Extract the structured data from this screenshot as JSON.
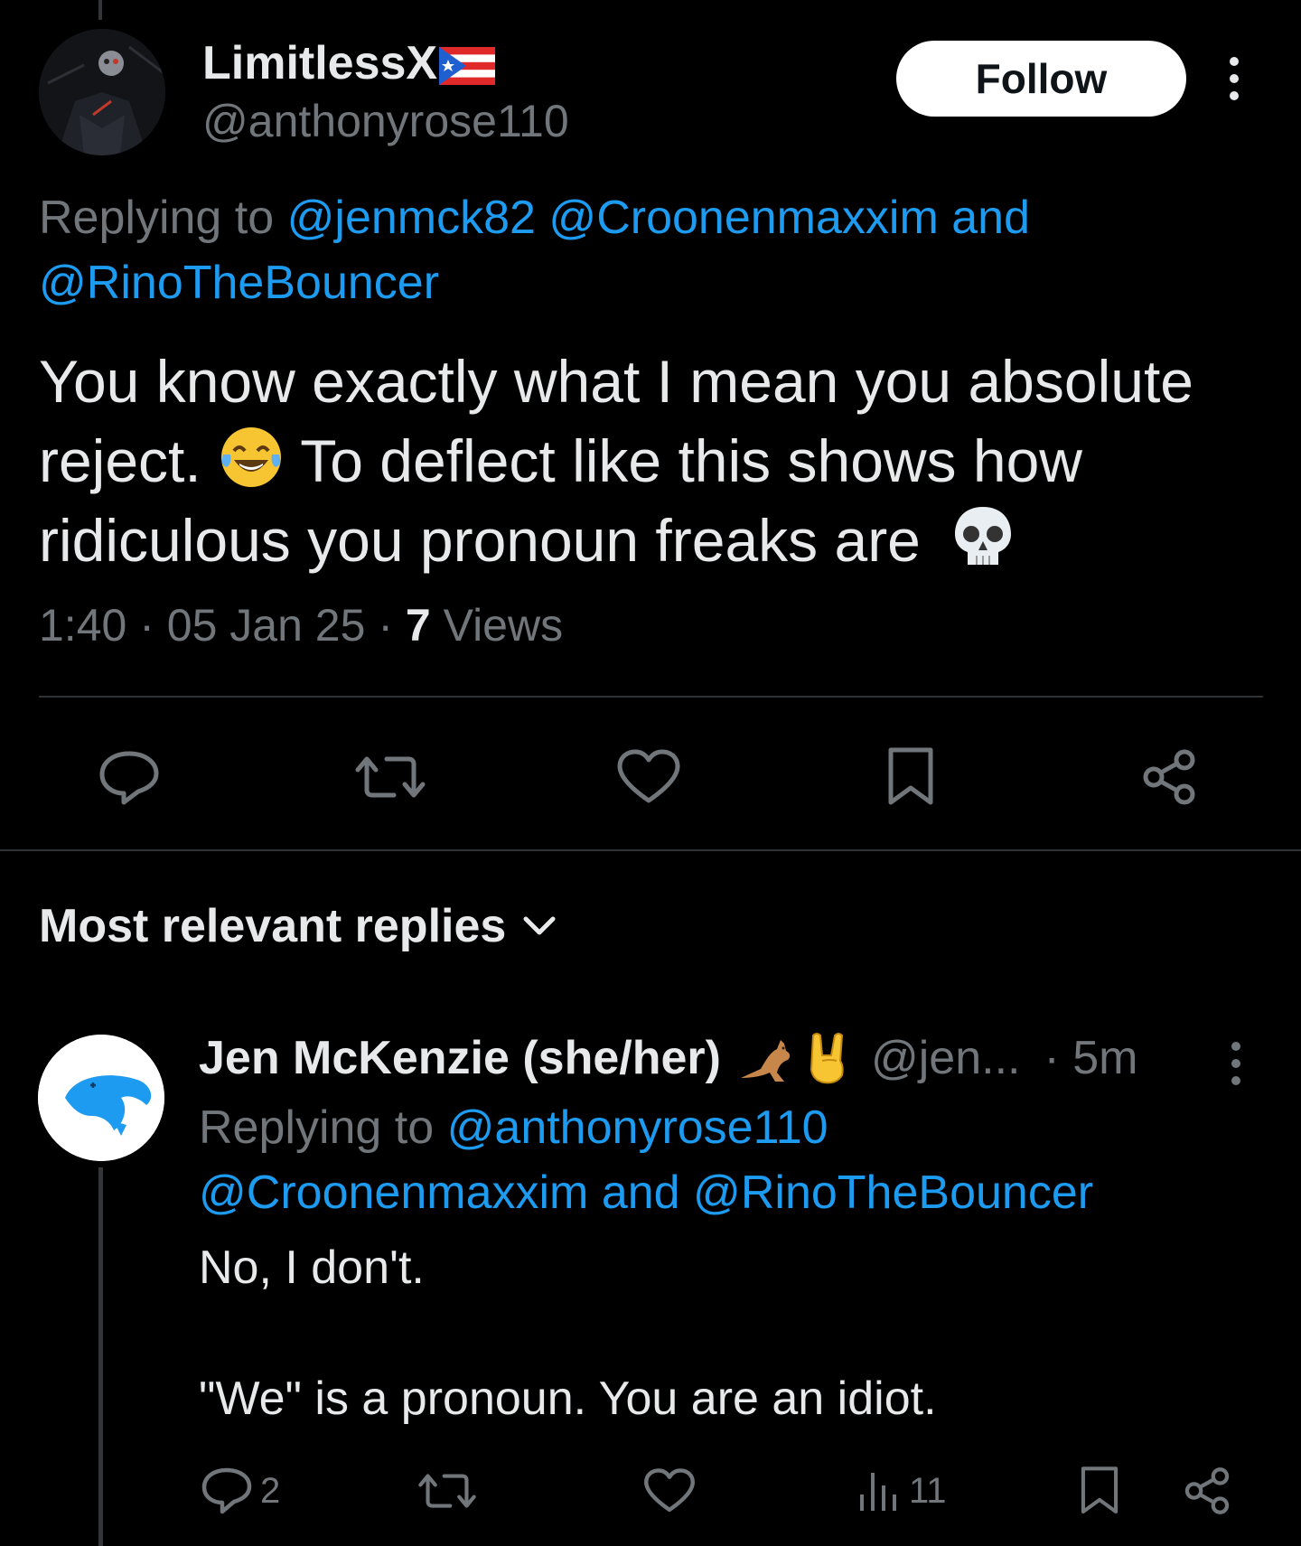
{
  "tweet": {
    "display_name": "LimitlessX",
    "flag_icon": "puerto-rico-flag-icon",
    "handle": "@anthonyrose110",
    "follow_label": "Follow",
    "replying_prefix": "Replying to",
    "replying_user_1": "@jenmck82",
    "replying_user_2": "@Croonenmaxxim",
    "replying_and": "and",
    "replying_user_3": "@RinoTheBouncer",
    "text_line_1": "You know exactly what I mean you absolute",
    "text_line_2a": "reject.",
    "text_line_2b": "To deflect like this shows how",
    "text_line_3": "ridiculous you pronoun freaks are",
    "emoji_1": "face-with-tears-of-joy-icon",
    "emoji_2": "skull-icon",
    "time": "1:40",
    "dot": "·",
    "date": "05 Jan 25",
    "views_count": "7",
    "views_label": "Views",
    "actions": [
      "reply-icon",
      "retweet-icon",
      "like-icon",
      "bookmark-icon",
      "share-icon"
    ]
  },
  "replies_section": {
    "sort_label": "Most relevant replies"
  },
  "reply": {
    "display_name": "Jen McKenzie (she/her)",
    "name_emojis": [
      "kangaroo-icon",
      "sign-of-the-horns-icon"
    ],
    "handle": "@jen...",
    "time": "· 5m",
    "replying_prefix": "Replying to",
    "replying_user_1": "@anthonyrose110",
    "replying_user_2": "@Croonenmaxxim",
    "replying_and": "and",
    "replying_user_3": "@RinoTheBouncer",
    "text_line_1": "No, I don't.",
    "text_line_2": "\"We\" is a pronoun. You are an idiot.",
    "reply_count": "2",
    "view_count": "11"
  },
  "colors": {
    "background": "#000000",
    "text": "#e7e9ea",
    "secondary": "#71767b",
    "link": "#1d9bf0",
    "divider": "#2f3336"
  }
}
